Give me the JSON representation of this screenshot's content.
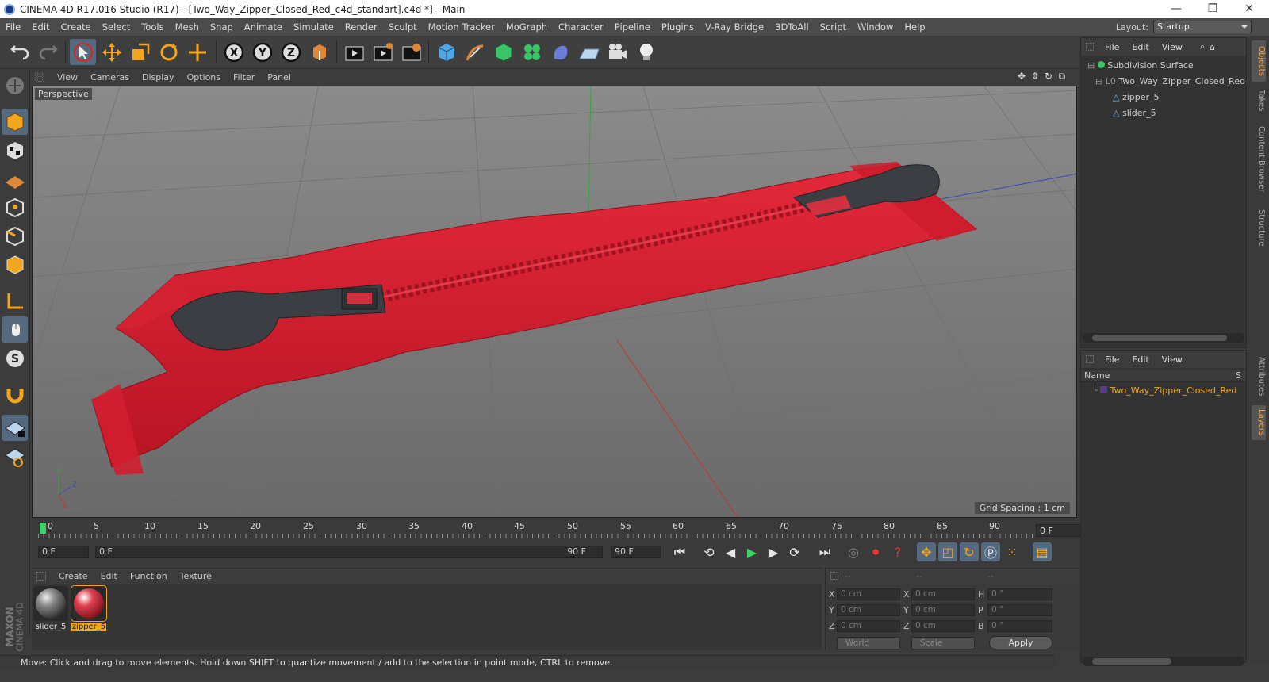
{
  "window": {
    "title": "CINEMA 4D R17.016 Studio (R17) - [Two_Way_Zipper_Closed_Red_c4d_standart].c4d *] - Main"
  },
  "menubar": {
    "items": [
      "File",
      "Edit",
      "Create",
      "Select",
      "Tools",
      "Mesh",
      "Snap",
      "Animate",
      "Simulate",
      "Render",
      "Sculpt",
      "Motion Tracker",
      "MoGraph",
      "Character",
      "Pipeline",
      "Plugins",
      "V-Ray Bridge",
      "3DToAll",
      "Script",
      "Window",
      "Help"
    ],
    "layout_label": "Layout:",
    "layout_value": "Startup"
  },
  "toolbar": {
    "icons": [
      "undo-icon",
      "redo-icon",
      "live-select-icon",
      "move-icon",
      "scale-icon",
      "rotate-icon",
      "recent-tool-icon",
      "x-axis-icon",
      "y-axis-icon",
      "z-axis-icon",
      "coordinate-system-icon",
      "render-view-icon",
      "render-picture-viewer-icon",
      "edit-render-settings-icon",
      "cube-icon",
      "pen-icon",
      "subdivision-icon",
      "cloner-icon",
      "deformer-icon",
      "floor-icon",
      "camera-icon",
      "light-icon"
    ]
  },
  "viewport": {
    "menu": [
      "View",
      "Cameras",
      "Display",
      "Options",
      "Filter",
      "Panel"
    ],
    "camera_label": "Perspective",
    "grid_spacing": "Grid Spacing : 1 cm"
  },
  "timeline": {
    "ticks": [
      "0",
      "5",
      "10",
      "15",
      "20",
      "25",
      "30",
      "35",
      "40",
      "45",
      "50",
      "55",
      "60",
      "65",
      "70",
      "75",
      "80",
      "85",
      "90"
    ],
    "current_frame": "0 F",
    "start_field": "0 F",
    "slider_start": "0 F",
    "slider_end": "90 F",
    "end_field": "90 F"
  },
  "materials": {
    "menu": [
      "Create",
      "Edit",
      "Function",
      "Texture"
    ],
    "items": [
      {
        "name": "slider_5",
        "color": "#6b6b6b"
      },
      {
        "name": "zipper_5",
        "color": "#d03040",
        "selected": true
      }
    ]
  },
  "coords": {
    "headers": [
      "--",
      "--",
      "--"
    ],
    "rows": [
      {
        "a": "X",
        "av": "0 cm",
        "b": "X",
        "bv": "0 cm",
        "c": "H",
        "cv": "0 °"
      },
      {
        "a": "Y",
        "av": "0 cm",
        "b": "Y",
        "bv": "0 cm",
        "c": "P",
        "cv": "0 °"
      },
      {
        "a": "Z",
        "av": "0 cm",
        "b": "Z",
        "bv": "0 cm",
        "c": "B",
        "cv": "0 °"
      }
    ],
    "world": "World",
    "scale": "Scale",
    "apply": "Apply"
  },
  "status": "Move: Click and drag to move elements. Hold down SHIFT to quantize movement / add to the selection in point mode, CTRL to remove.",
  "objects": {
    "menu": [
      "File",
      "Edit",
      "View"
    ],
    "items": [
      "Subdivision Surface",
      "Two_Way_Zipper_Closed_Red",
      "zipper_5",
      "slider_5"
    ]
  },
  "layers": {
    "menu": [
      "File",
      "Edit",
      "View"
    ],
    "col_name": "Name",
    "col_s": "S",
    "items": [
      "Two_Way_Zipper_Closed_Red"
    ]
  },
  "sidetabs": [
    "Objects",
    "Takes",
    "Content Browser",
    "Structure",
    "Attributes",
    "Layers"
  ],
  "brand": {
    "line1": "MAXON",
    "line2": "CINEMA 4D"
  }
}
